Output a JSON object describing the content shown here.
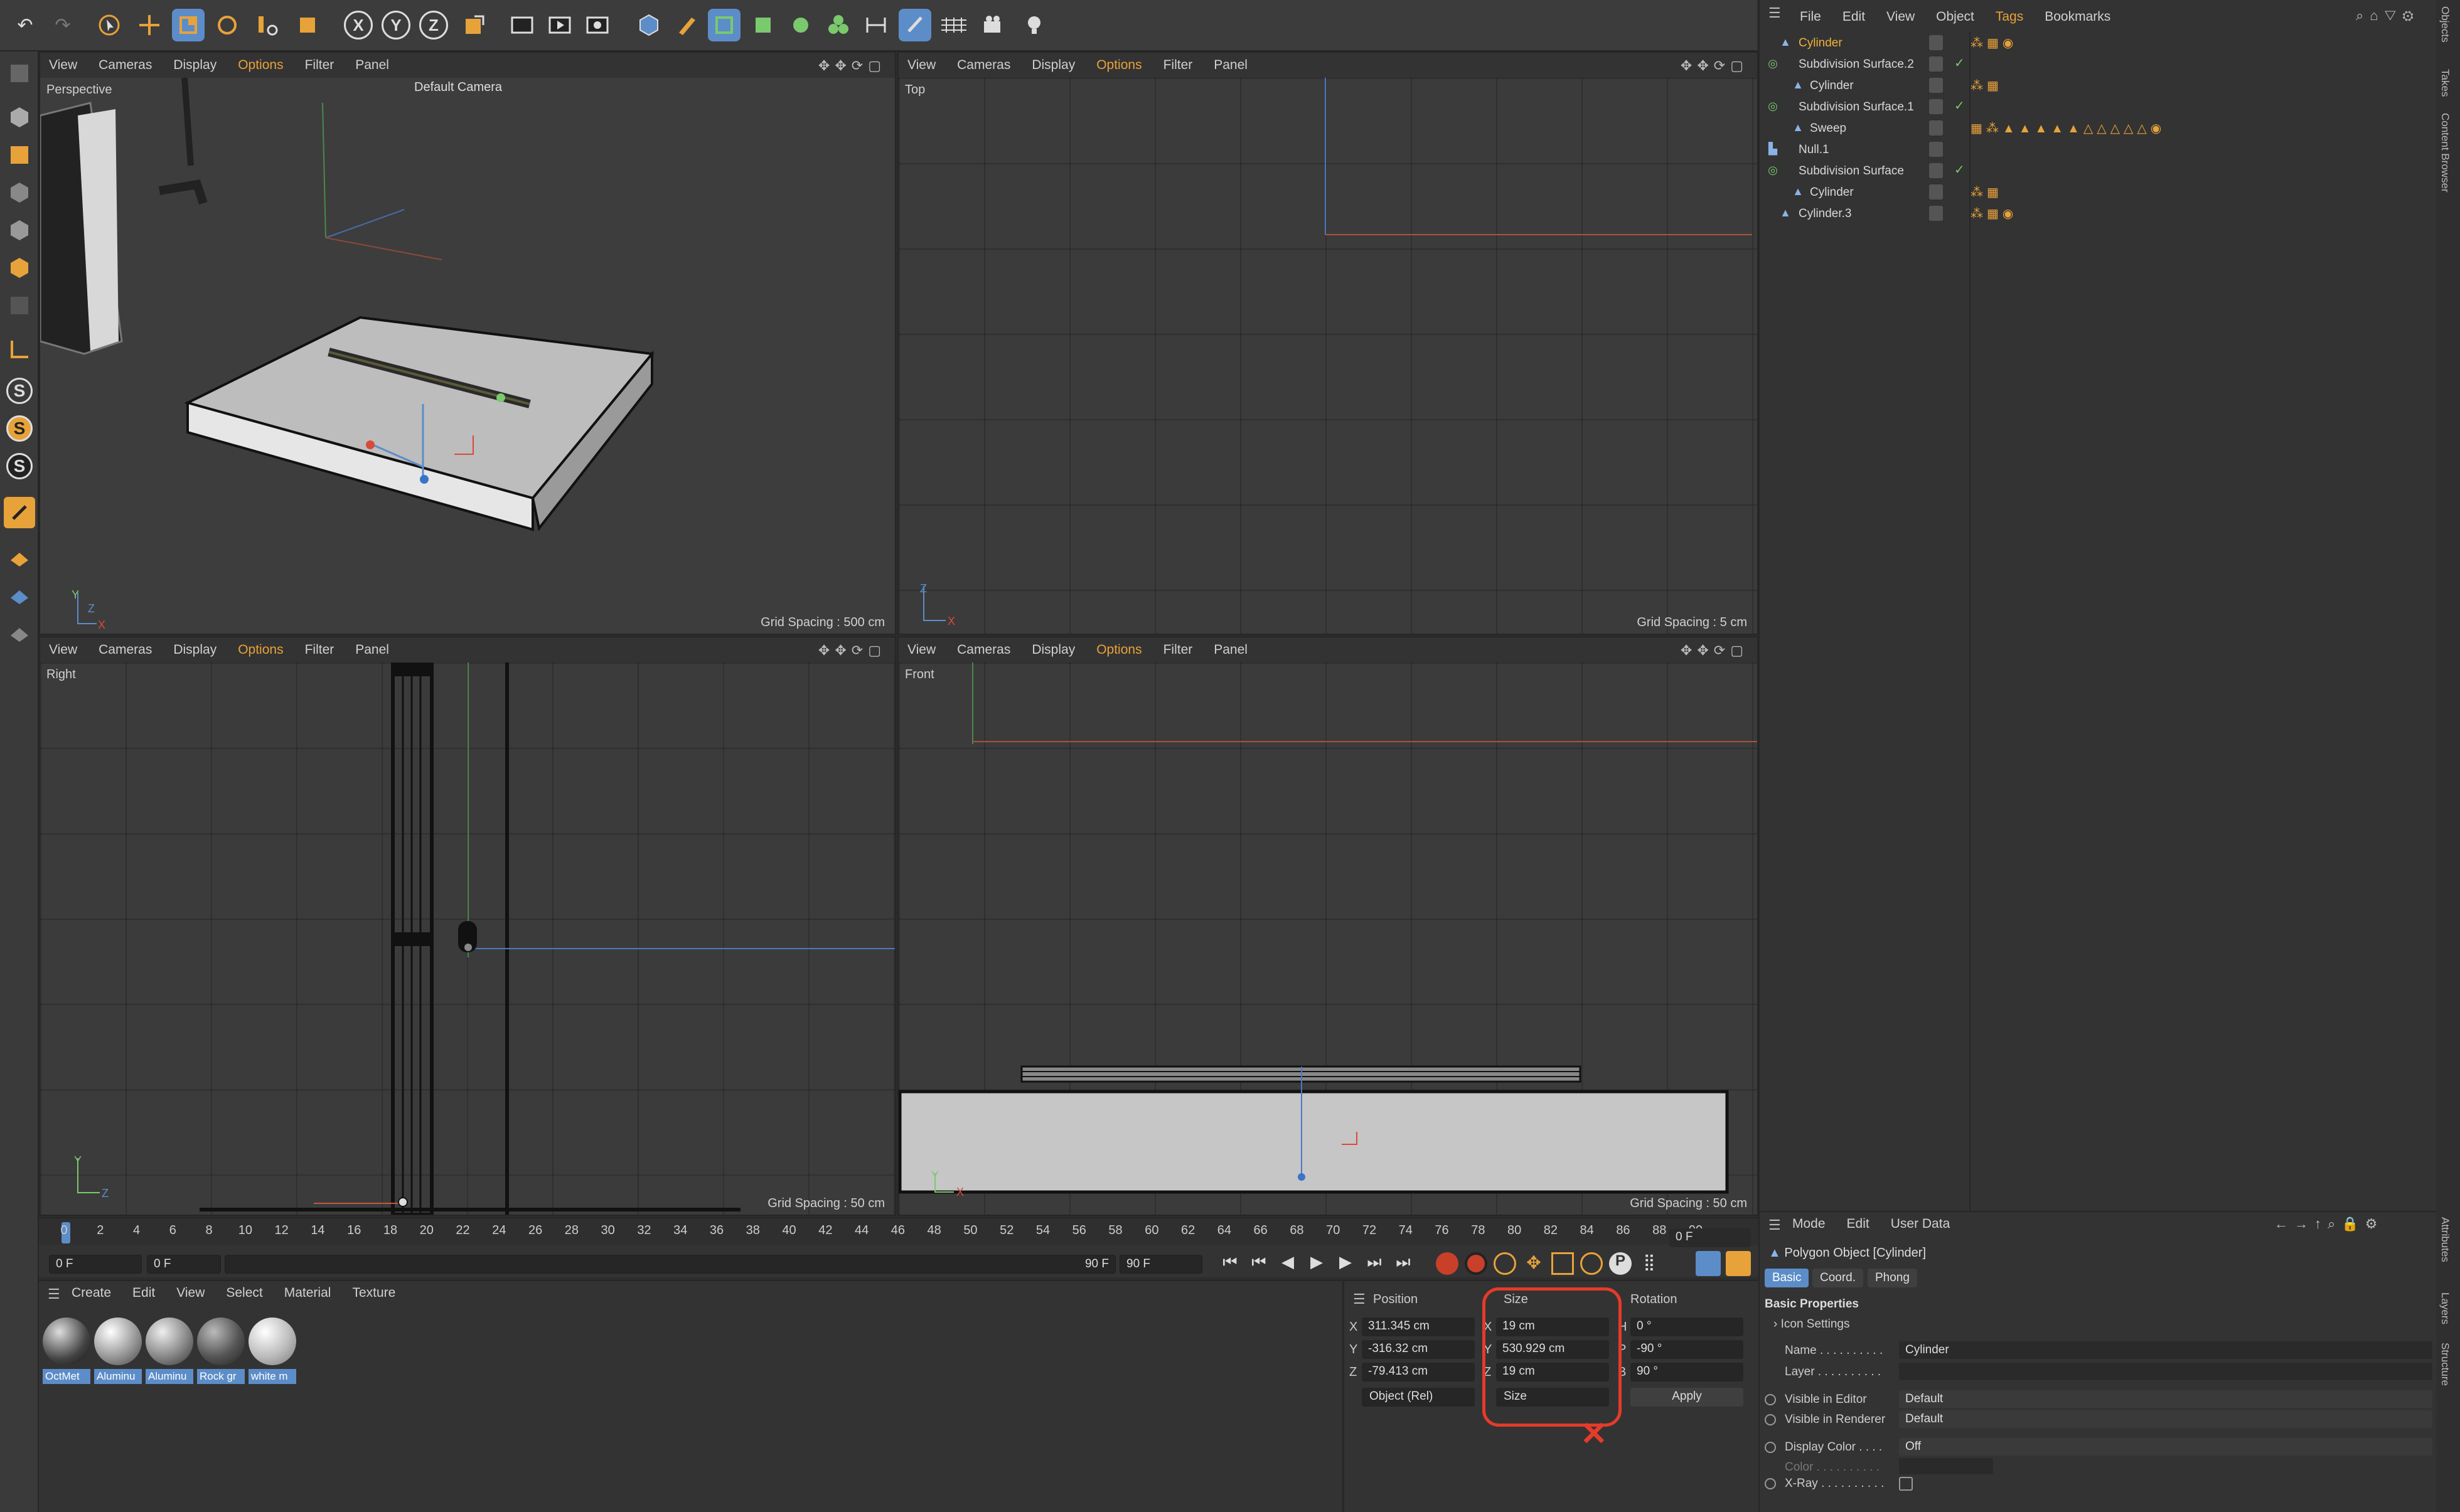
{
  "toolbar": {
    "undo": "↶",
    "redo": "↷",
    "axis_x": "X",
    "axis_y": "Y",
    "axis_z": "Z"
  },
  "left_toolbar": {
    "s1": "S",
    "s2": "S",
    "s3": "S"
  },
  "viewport_menu": [
    "View",
    "Cameras",
    "Display",
    "Options",
    "Filter",
    "Panel"
  ],
  "viewports": {
    "perspective": {
      "title": "Perspective",
      "camera": "Default Camera",
      "grid": "Grid Spacing : 500 cm"
    },
    "top": {
      "title": "Top",
      "grid": "Grid Spacing : 5 cm"
    },
    "right": {
      "title": "Right",
      "grid": "Grid Spacing : 50 cm"
    },
    "front": {
      "title": "Front",
      "grid": "Grid Spacing : 50 cm"
    }
  },
  "timeline": {
    "ticks": [
      "0",
      "2",
      "4",
      "6",
      "8",
      "10",
      "12",
      "14",
      "16",
      "18",
      "20",
      "22",
      "24",
      "26",
      "28",
      "30",
      "32",
      "34",
      "36",
      "38",
      "40",
      "42",
      "44",
      "46",
      "48",
      "50",
      "52",
      "54",
      "56",
      "58",
      "60",
      "62",
      "64",
      "66",
      "68",
      "70",
      "72",
      "74",
      "76",
      "78",
      "80",
      "82",
      "84",
      "86",
      "88",
      "90"
    ],
    "current_frame": "0 F",
    "start_frame": "0 F",
    "offset_frame": "0 F",
    "end_frame": "90 F",
    "max_frame": "90 F"
  },
  "material_manager": {
    "menu": [
      "Create",
      "Edit",
      "View",
      "Select",
      "Material",
      "Texture"
    ],
    "materials": [
      "OctMet",
      "Aluminu",
      "Aluminu",
      "Rock gr",
      "white m"
    ]
  },
  "coordinates": {
    "headers": {
      "position": "Position",
      "size": "Size",
      "rotation": "Rotation"
    },
    "position": {
      "x": "311.345 cm",
      "y": "-316.32 cm",
      "z": "-79.413 cm"
    },
    "size": {
      "x": "19 cm",
      "y": "530.929 cm",
      "z": "19 cm"
    },
    "rotation": {
      "h": "0 °",
      "p": "-90 °",
      "b": "90 °"
    },
    "axis_labels": {
      "x": "X",
      "y": "Y",
      "z": "Z",
      "h": "H",
      "p": "P",
      "b": "B"
    },
    "mode_select": "Object (Rel)",
    "size_select": "Size",
    "apply": "Apply"
  },
  "object_manager": {
    "menu": [
      "File",
      "Edit",
      "View",
      "Object",
      "Tags",
      "Bookmarks"
    ],
    "objects": [
      {
        "name": "Cylinder",
        "selected": true
      },
      {
        "name": "Subdivision Surface.2"
      },
      {
        "name": "Cylinder"
      },
      {
        "name": "Subdivision Surface.1"
      },
      {
        "name": "Sweep"
      },
      {
        "name": "Null.1"
      },
      {
        "name": "Subdivision Surface"
      },
      {
        "name": "Cylinder"
      },
      {
        "name": "Cylinder.3"
      }
    ]
  },
  "attributes": {
    "menu": [
      "Mode",
      "Edit",
      "User Data"
    ],
    "object_type": "Polygon Object [Cylinder]",
    "tabs": [
      "Basic",
      "Coord.",
      "Phong"
    ],
    "section": "Basic Properties",
    "icon_settings": "Icon Settings",
    "fields": [
      {
        "label": "Name . . . . . . . . . .",
        "value": "Cylinder"
      },
      {
        "label": "Layer . . . . . . . . . .",
        "value": ""
      },
      {
        "label": "Visible in Editor",
        "value": "Default"
      },
      {
        "label": "Visible in Renderer",
        "value": "Default"
      },
      {
        "label": "Display Color . . . .",
        "value": "Off"
      },
      {
        "label": "Color . . . . . . . . . .",
        "value": ""
      },
      {
        "label": "X-Ray . . . . . . . . . .",
        "value": ""
      }
    ]
  },
  "side_strip": [
    "Objects",
    "Takes",
    "Content Browser",
    "Attributes",
    "Layers",
    "Structure"
  ],
  "annotation": {
    "mark": "✕"
  },
  "colors": {
    "accent_blue": "#5c8dc8",
    "selection_orange": "#f0b23a",
    "annotation_red": "#e53b2a"
  }
}
